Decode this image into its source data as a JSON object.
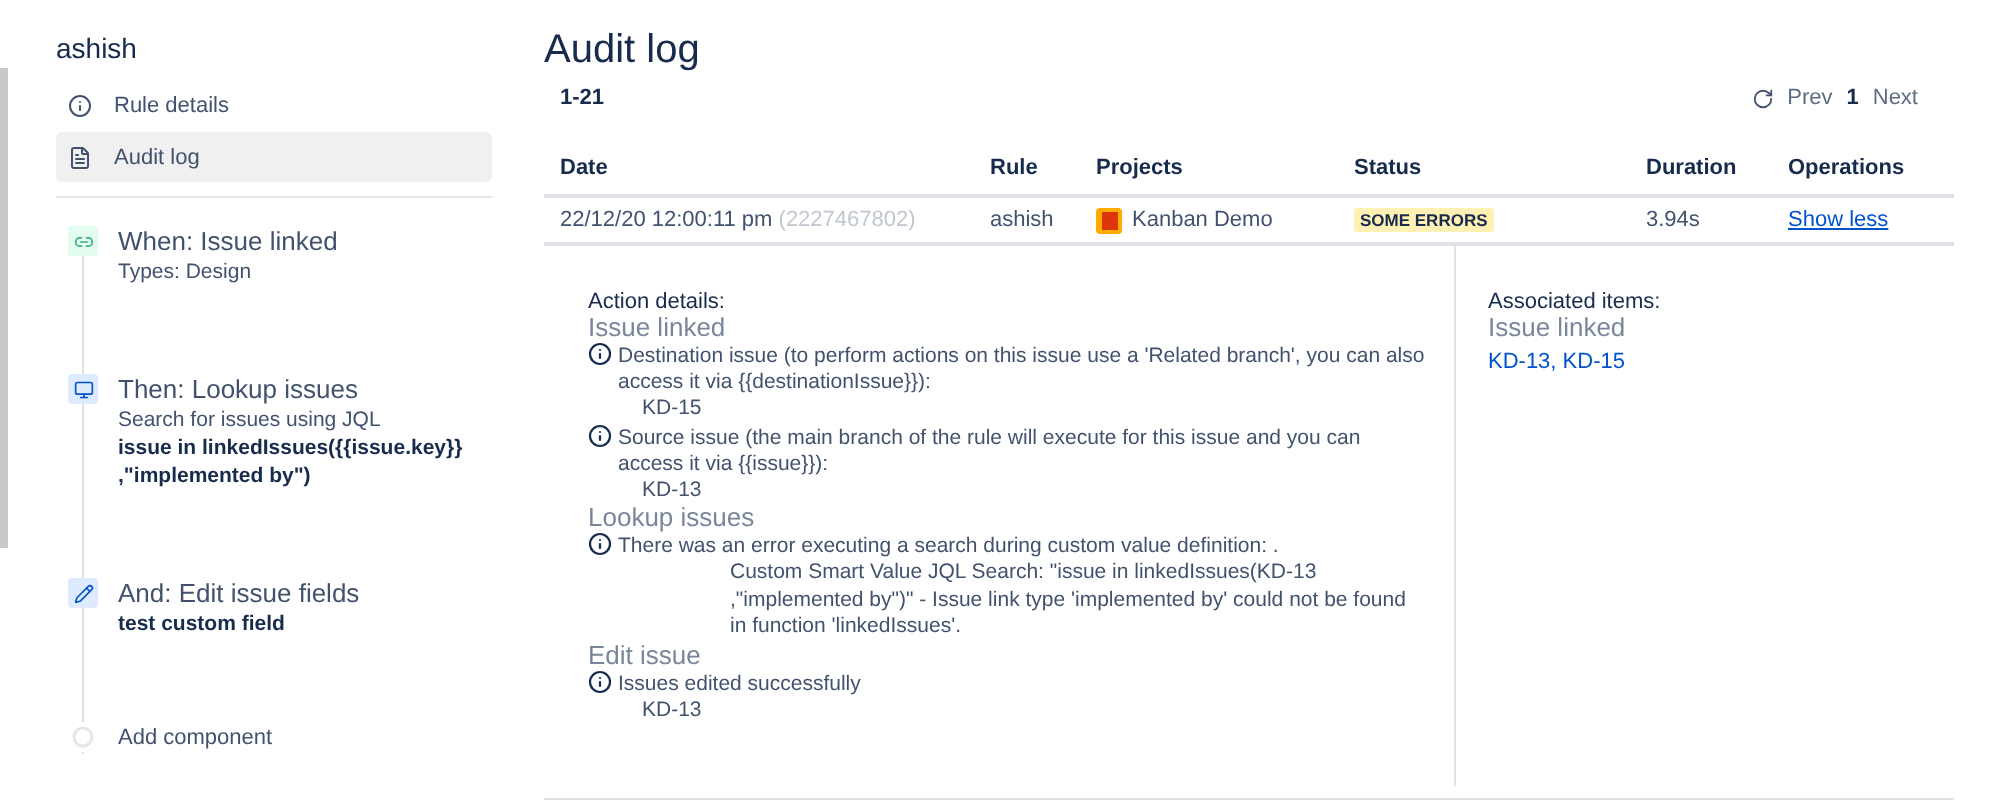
{
  "sidebar": {
    "title": "ashish",
    "nav": [
      {
        "label": "Rule details",
        "kind": "info",
        "selected": false
      },
      {
        "label": "Audit log",
        "kind": "page",
        "selected": true
      }
    ],
    "steps": [
      {
        "kind": "trigger",
        "title": "When: Issue linked",
        "lines": [
          {
            "text": "Types: Design",
            "bold": false
          }
        ]
      },
      {
        "kind": "lookup",
        "title": "Then: Lookup issues",
        "lines": [
          {
            "text": "Search for issues using JQL",
            "bold": false
          },
          {
            "text": "issue in linkedIssues({{issue.key}} ,\"implemented by\")",
            "bold": true
          }
        ]
      },
      {
        "kind": "edit",
        "title": "And: Edit issue fields",
        "lines": [
          {
            "text": "test custom field",
            "bold": true
          }
        ]
      },
      {
        "kind": "add",
        "title": "Add component"
      }
    ]
  },
  "main": {
    "title": "Audit log",
    "range": "1-21",
    "pagination": {
      "prev": "Prev",
      "pages": [
        {
          "label": "1",
          "selected": true
        }
      ],
      "next": "Next"
    },
    "table": {
      "columns": [
        "Date",
        "Rule",
        "Projects",
        "Status",
        "Duration",
        "Operations"
      ],
      "rows": [
        {
          "date": "22/12/20 12:00:11 pm",
          "id": "(2227467802)",
          "rule": "ashish",
          "project": "Kanban Demo",
          "status": "SOME ERRORS",
          "duration": "3.94s",
          "operation": "Show less",
          "expanded": true
        }
      ]
    },
    "details": {
      "heading": "Action details:",
      "sections": [
        {
          "title": "Issue linked",
          "messages": [
            {
              "text": "Destination issue (to perform actions on this issue use a 'Related branch', you can also access it via {{destinationIssue}}):",
              "detail": "KD-15"
            },
            {
              "text": "Source issue (the main branch of the rule will execute for this issue and you can access it via {{issue}}):",
              "detail": "KD-13"
            }
          ]
        },
        {
          "title": "Lookup issues",
          "messages": [
            {
              "text": "There was an error executing a search during custom value definition: .",
              "detail": "Custom Smart Value JQL Search: \"issue in linkedIssues(KD-13 ,\"implemented by\")\" - Issue link type 'implemented by' could not be found in function 'linkedIssues'."
            }
          ]
        },
        {
          "title": "Edit issue",
          "messages": [
            {
              "text": "Issues edited successfully",
              "detail": "KD-13"
            }
          ]
        }
      ]
    },
    "associated": {
      "heading": "Associated items:",
      "title": "Issue linked",
      "items": "KD-13, KD-15"
    }
  }
}
